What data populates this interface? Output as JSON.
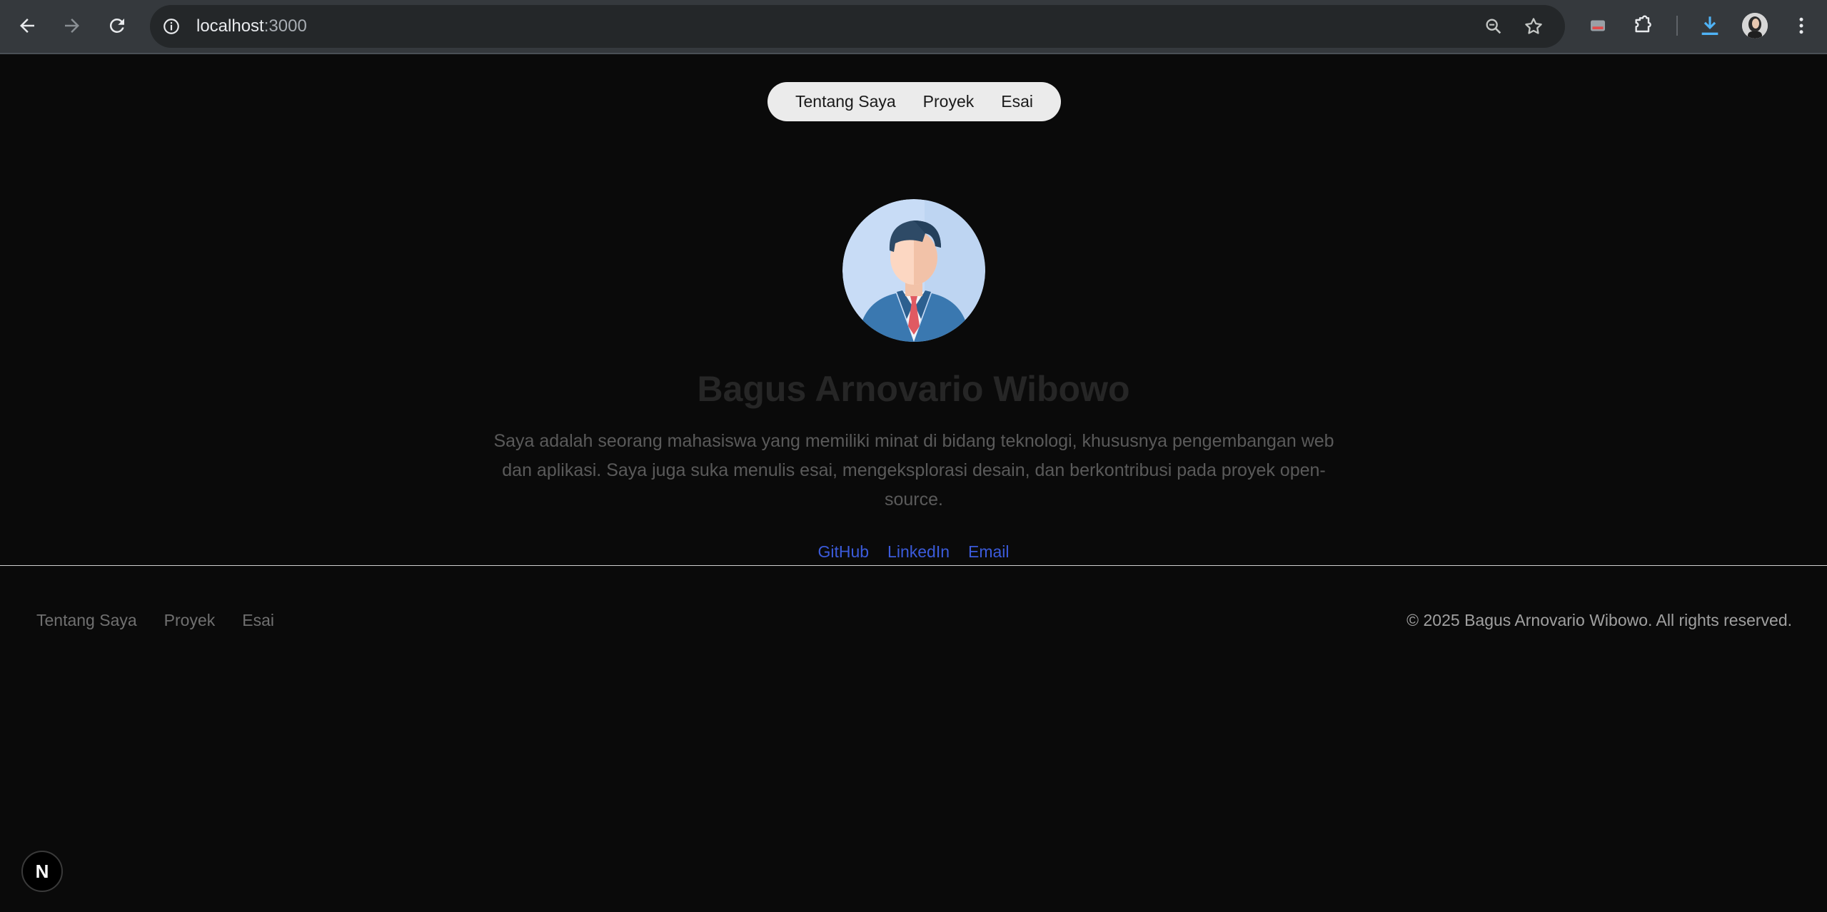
{
  "browser": {
    "url_host": "localhost",
    "url_port": ":3000",
    "icons": [
      "back-icon",
      "forward-icon",
      "reload-icon",
      "site-info-icon",
      "zoom-icon",
      "bookmark-star-icon",
      "cast-icon",
      "extensions-icon",
      "download-icon",
      "profile-avatar",
      "menu-icon"
    ]
  },
  "nav": {
    "items": [
      {
        "label": "Tentang Saya"
      },
      {
        "label": "Proyek"
      },
      {
        "label": "Esai"
      }
    ]
  },
  "profile": {
    "name": "Bagus Arnovario Wibowo",
    "bio": "Saya adalah seorang mahasiswa yang memiliki minat di bidang teknologi, khususnya pengembangan web dan aplikasi. Saya juga suka menulis esai, mengeksplorasi desain, dan berkontribusi pada proyek open-source."
  },
  "social": {
    "links": [
      {
        "label": "GitHub"
      },
      {
        "label": "LinkedIn"
      },
      {
        "label": "Email"
      }
    ]
  },
  "footer": {
    "items": [
      {
        "label": "Tentang Saya"
      },
      {
        "label": "Proyek"
      },
      {
        "label": "Esai"
      }
    ],
    "copyright": "© 2025 Bagus Arnovario Wibowo. All rights reserved."
  },
  "dev_badge": {
    "label": "N"
  },
  "colors": {
    "background": "#0a0a0a",
    "link": "#3b5bdb",
    "pill": "#ebebeb"
  }
}
